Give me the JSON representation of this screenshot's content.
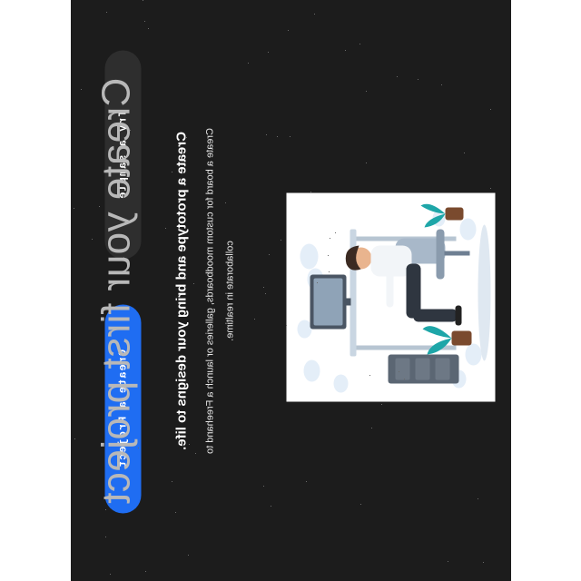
{
  "hero": {
    "title": "Create your first project",
    "subtitle": "Create a prototype and bring your designs to life.",
    "description": "Create a board for custom moodboards, galleries or launch a Freehand to collaborate in realtime."
  },
  "actions": {
    "try_sample_label": "Try a sample",
    "create_project_label": "Create a Project"
  },
  "colors": {
    "panel_background": "#1c1c1c",
    "primary_button": "#1f6df2",
    "secondary_button": "#2e2e2e",
    "title_text": "#b8b8b8"
  },
  "illustration": {
    "icon": "person-at-desk-illustration"
  }
}
